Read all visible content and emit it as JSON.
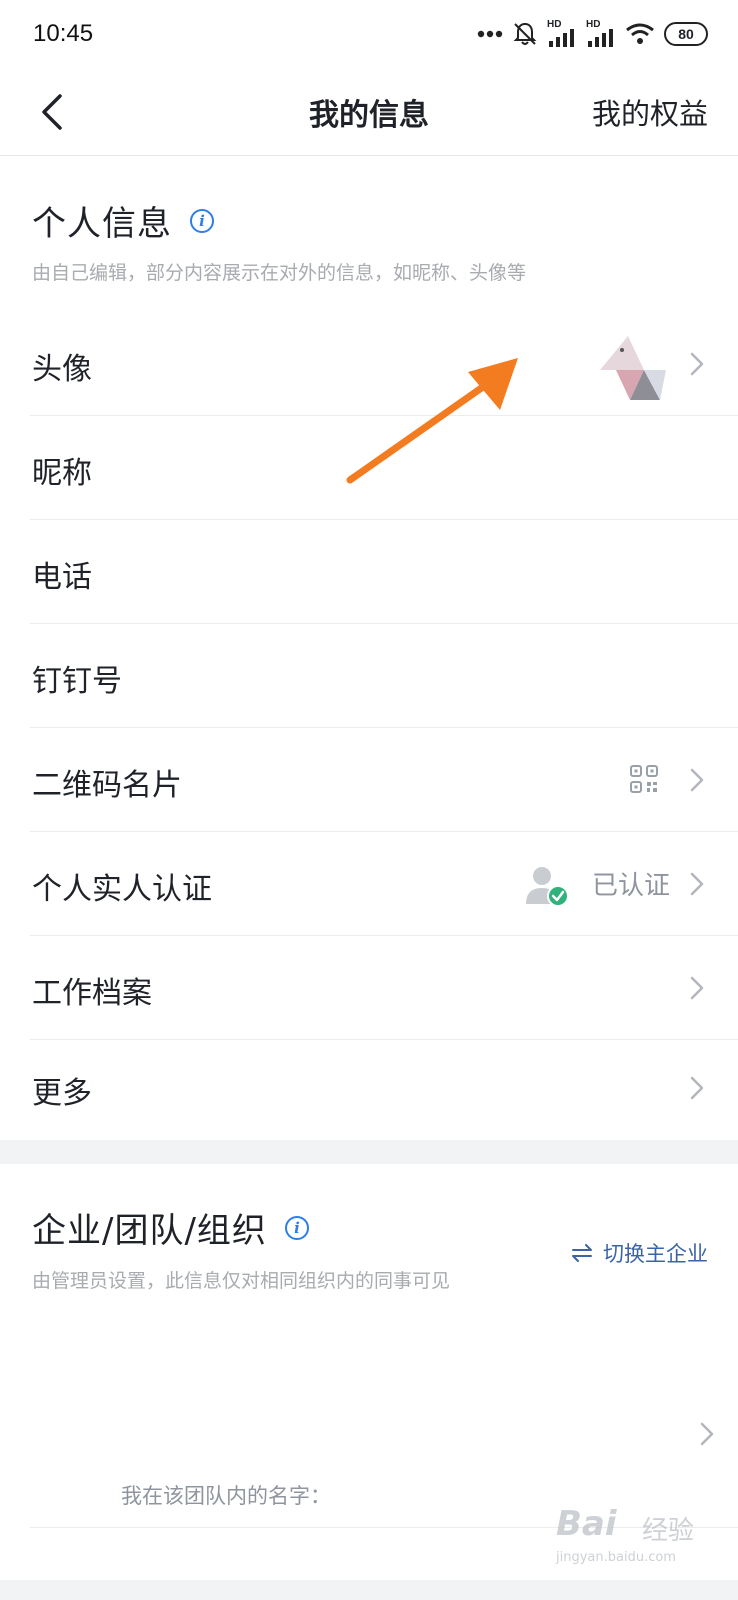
{
  "status_bar": {
    "time": "10:45",
    "hd_label": "HD",
    "battery": "80",
    "icons": [
      "more-dots-icon",
      "bell-muted-icon",
      "signal-hd-icon",
      "signal-hd-icon",
      "wifi-icon",
      "battery-icon"
    ]
  },
  "nav": {
    "title": "我的信息",
    "right_action": "我的权益",
    "back_icon": "chevron-left-icon"
  },
  "personal": {
    "title": "个人信息",
    "info_icon": "i",
    "description": "由自己编辑，部分内容展示在对外的信息，如昵称、头像等",
    "rows": [
      {
        "label": "头像"
      },
      {
        "label": "昵称"
      },
      {
        "label": "电话"
      },
      {
        "label": "钉钉号"
      },
      {
        "label": "二维码名片"
      },
      {
        "label": "个人实人认证",
        "value": "已认证"
      },
      {
        "label": "工作档案"
      },
      {
        "label": "更多"
      }
    ]
  },
  "org": {
    "title": "企业/团队/组织",
    "info_icon": "i",
    "switch_label": "切换主企业",
    "switch_icon": "swap-arrows-icon",
    "description": "由管理员设置，此信息仅对相同组织内的同事可见",
    "team_name_label": "我在该团队内的名字："
  },
  "watermark": {
    "brand": "Bai",
    "cn": "经验",
    "url": "jingyan.baidu.com"
  },
  "colors": {
    "accent_blue": "#2d7ee6",
    "link_blue": "#3c64a4",
    "annotation_orange": "#f47c20",
    "verified_green": "#2fb37b"
  }
}
